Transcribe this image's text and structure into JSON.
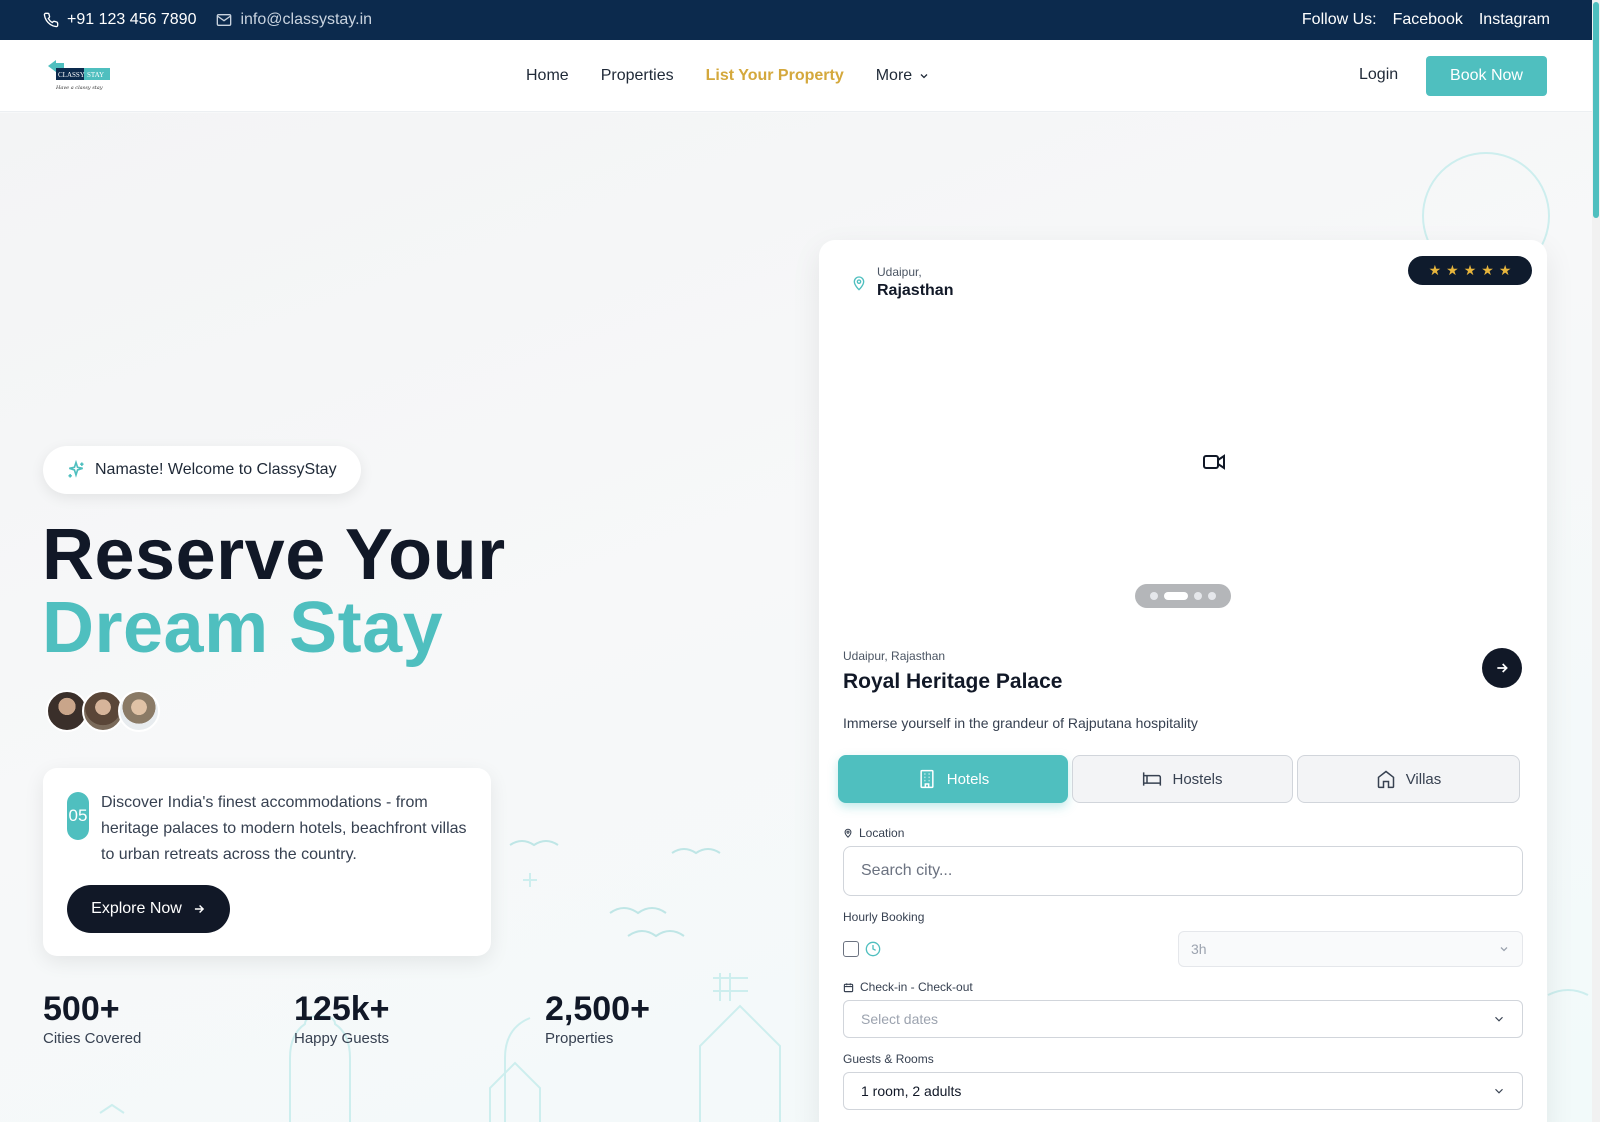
{
  "topbar": {
    "phone": "+91 123 456 7890",
    "email": "info@classystay.in",
    "follow_label": "Follow Us:",
    "social": [
      "Facebook",
      "Instagram"
    ]
  },
  "header": {
    "logo_text": "CLASSY STAY",
    "logo_tagline": "Have a classy stay",
    "nav": [
      "Home",
      "Properties",
      "List Your Property",
      "More"
    ],
    "login": "Login",
    "book_now": "Book Now"
  },
  "hero": {
    "welcome": "Namaste! Welcome to ClassyStay",
    "title_line1": "Reserve Your",
    "title_line2": "Dream Stay",
    "badge": "05",
    "description": "Discover India's finest accommodations - from heritage palaces to modern hotels, beachfront villas to urban retreats across the country.",
    "cta": "Explore Now",
    "stats": [
      {
        "value": "500+",
        "label": "Cities Covered"
      },
      {
        "value": "125k+",
        "label": "Happy Guests"
      },
      {
        "value": "2,500+",
        "label": "Properties"
      }
    ]
  },
  "card": {
    "top_city": "Udaipur,",
    "top_state": "Rajasthan",
    "rating_stars": 5,
    "carousel_active_index": 1,
    "carousel_count": 4,
    "property_location": "Udaipur, Rajasthan",
    "property_name": "Royal Heritage Palace",
    "property_desc": "Immerse yourself in the grandeur of Rajputana hospitality",
    "tabs": [
      "Hotels",
      "Hostels",
      "Villas"
    ],
    "active_tab": "Hotels",
    "location_label": "Location",
    "location_placeholder": "Search city...",
    "hourly_label": "Hourly Booking",
    "hours_value": "3h",
    "dates_label": "Check-in - Check-out",
    "dates_placeholder": "Select dates",
    "guests_label": "Guests & Rooms",
    "guests_value": "1 room, 2 adults"
  },
  "colors": {
    "accent": "#4fbfbf",
    "topbar": "#0c2a4d",
    "gold": "#d4a83c",
    "dark": "#111827"
  }
}
